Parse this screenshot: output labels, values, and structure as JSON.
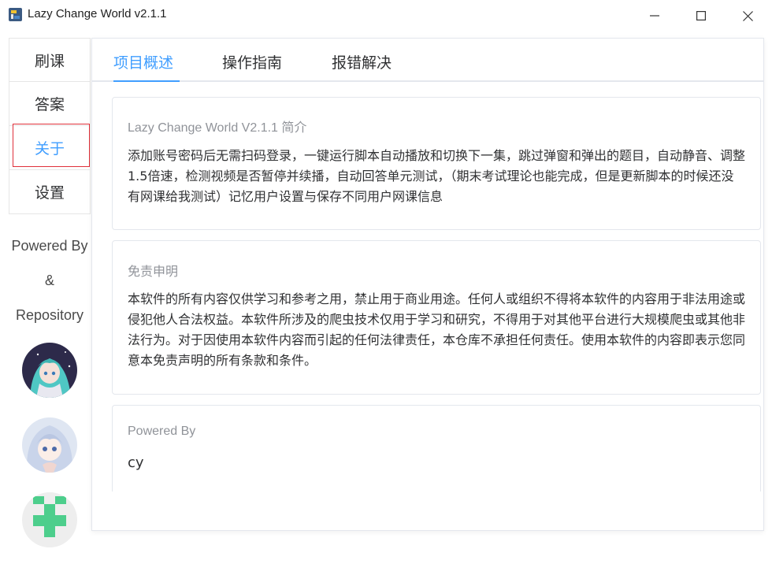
{
  "window": {
    "title": "Lazy Change World v2.1.1"
  },
  "sidebar": {
    "items": [
      {
        "label": "刷课"
      },
      {
        "label": "答案"
      },
      {
        "label": "关于"
      },
      {
        "label": "设置"
      }
    ],
    "active_index": 2,
    "powered": [
      "Powered By",
      "&",
      "Repository"
    ]
  },
  "tabs": [
    {
      "label": "项目概述"
    },
    {
      "label": "操作指南"
    },
    {
      "label": "报错解决"
    }
  ],
  "cards": {
    "intro": {
      "title": "Lazy Change World V2.1.1 简介",
      "body": "添加账号密码后无需扫码登录，一键运行脚本自动播放和切换下一集，跳过弹窗和弹出的题目，自动静音、调整1.5倍速，检测视频是否暂停并续播，自动回答单元测试，（期末考试理论也能完成，但是更新脚本的时候还没有网课给我测试）记忆用户设置与保存不同用户网课信息"
    },
    "disclaimer": {
      "title": "免责申明",
      "body": "本软件的所有内容仅供学习和参考之用，禁止用于商业用途。任何人或组织不得将本软件的内容用于非法用途或侵犯他人合法权益。本软件所涉及的爬虫技术仅用于学习和研究，不得用于对其他平台进行大规模爬虫或其他非法行为。对于因使用本软件内容而引起的任何法律责任，本仓库不承担任何责任。使用本软件的内容即表示您同意本免责声明的所有条款和条件。"
    },
    "powered": {
      "title": "Powered By",
      "body": "cy"
    }
  },
  "colors": {
    "accent": "#409eff",
    "highlight_box": "#e0303a"
  }
}
